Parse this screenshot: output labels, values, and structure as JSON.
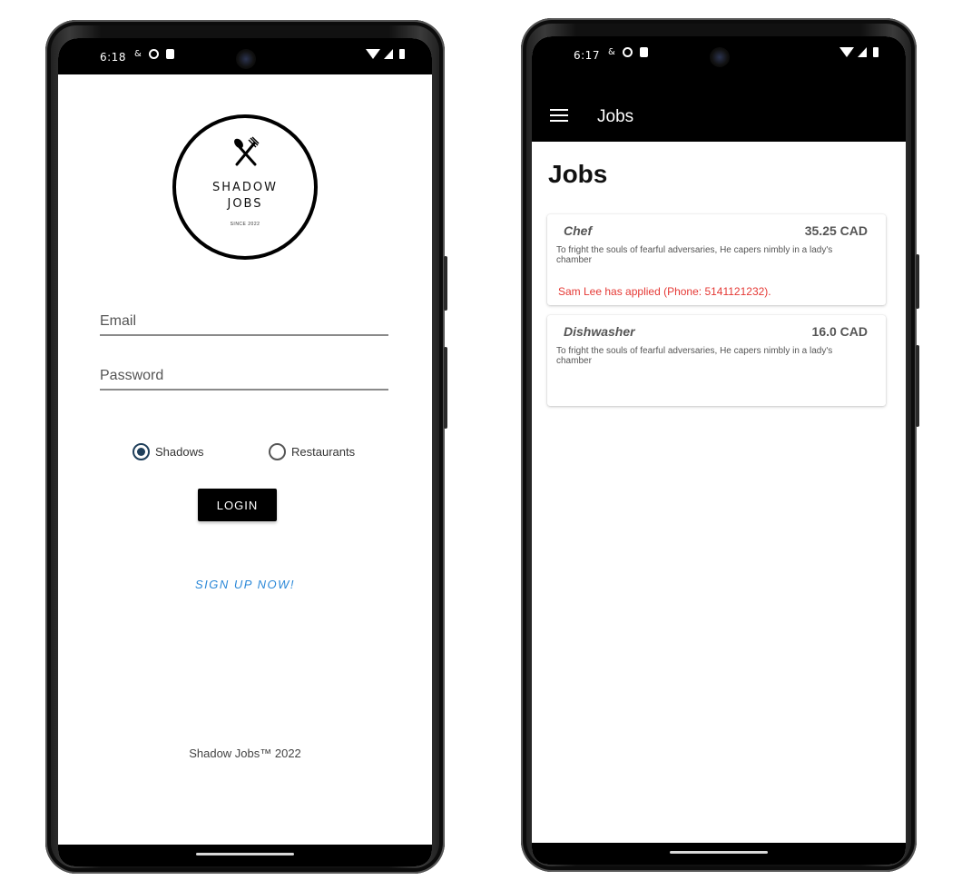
{
  "login_screen": {
    "status_time": "6:18",
    "logo": {
      "line1": "SHADOW",
      "line2": "JOBS",
      "since": "SINCE 2022"
    },
    "email_placeholder": "Email",
    "password_placeholder": "Password",
    "roles": [
      {
        "label": "Shadows",
        "selected": true
      },
      {
        "label": "Restaurants",
        "selected": false
      }
    ],
    "login_label": "LOGIN",
    "signup_label": "SIGN UP NOW!",
    "footer": "Shadow Jobs™ 2022"
  },
  "jobs_screen": {
    "status_time": "6:17",
    "appbar_title": "Jobs",
    "heading": "Jobs",
    "jobs": [
      {
        "title": "Chef",
        "pay": "35.25 CAD",
        "description": "To fright the souls of fearful adversaries, He capers nimbly in a lady's chamber",
        "applicant_note": "Sam Lee has applied (Phone: 5141121232)."
      },
      {
        "title": "Dishwasher",
        "pay": "16.0 CAD",
        "description": "To fright the souls of fearful adversaries, He capers nimbly in a lady's chamber",
        "applicant_note": ""
      }
    ]
  },
  "colors": {
    "accent_link": "#2b88d8",
    "applied_text": "#e53935",
    "radio_selected": "#1f3f5b",
    "bars": "#000000"
  }
}
